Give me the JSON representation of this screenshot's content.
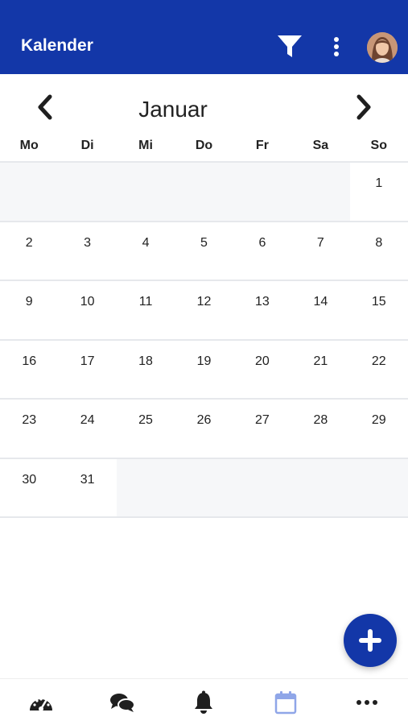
{
  "header": {
    "title": "Kalender",
    "filter_icon": "filter-icon",
    "more_icon": "more-vertical-icon",
    "avatar": "user-avatar"
  },
  "calendar": {
    "month": "Januar",
    "prev_icon": "chevron-left-icon",
    "next_icon": "chevron-right-icon",
    "weekdays": [
      "Mo",
      "Di",
      "Mi",
      "Do",
      "Fr",
      "Sa",
      "So"
    ],
    "leading_empty_days": 6,
    "days": [
      "1",
      "2",
      "3",
      "4",
      "5",
      "6",
      "7",
      "8",
      "9",
      "10",
      "11",
      "12",
      "13",
      "14",
      "15",
      "16",
      "17",
      "18",
      "19",
      "20",
      "21",
      "22",
      "23",
      "24",
      "25",
      "26",
      "27",
      "28",
      "29",
      "30",
      "31"
    ],
    "trailing_empty_days": 5
  },
  "fab": {
    "icon": "plus-icon"
  },
  "bottom_nav": {
    "items": [
      {
        "icon": "dashboard-gauge-icon"
      },
      {
        "icon": "chat-bubbles-icon"
      },
      {
        "icon": "bell-icon"
      },
      {
        "icon": "calendar-icon",
        "active": true
      },
      {
        "icon": "more-horizontal-icon"
      }
    ]
  },
  "colors": {
    "brand": "#1337a8",
    "active_nav": "#8fa6e8",
    "empty_cell": "#f6f7f9",
    "grid_line": "#e6e8ec"
  }
}
